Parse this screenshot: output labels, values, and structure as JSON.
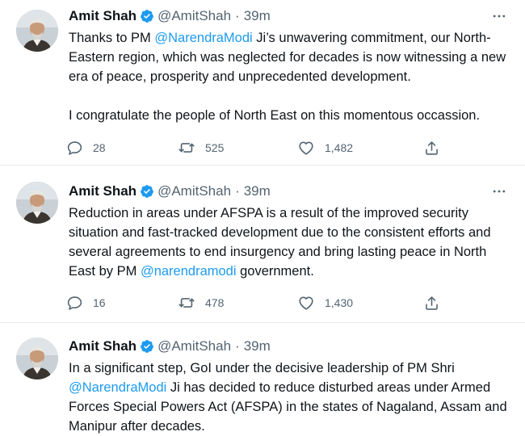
{
  "tweets": [
    {
      "author_name": "Amit Shah",
      "handle": "@AmitShah",
      "separator": "·",
      "time": "39m",
      "text_parts": [
        "Thanks to PM ",
        "@NarendraModi",
        " Ji’s unwavering commitment, our North-Eastern region, which was neglected for decades is now witnessing a new era of peace, prosperity and unprecedented development."
      ],
      "text_second_paragraph": "I congratulate the people of North East on this momentous occassion.",
      "replies": "28",
      "retweets": "525",
      "likes": "1,482"
    },
    {
      "author_name": "Amit Shah",
      "handle": "@AmitShah",
      "separator": "·",
      "time": "39m",
      "text_parts": [
        "Reduction in areas under AFSPA is a result of the improved security situation and fast-tracked development due to the consistent efforts and several agreements to end insurgency and bring lasting peace in North East by PM ",
        "@narendramodi",
        " government."
      ],
      "replies": "16",
      "retweets": "478",
      "likes": "1,430"
    },
    {
      "author_name": "Amit Shah",
      "handle": "@AmitShah",
      "separator": "·",
      "time": "39m",
      "text_parts": [
        "In a significant step, GoI under the decisive leadership of PM Shri ",
        "@NarendraModi",
        " Ji has decided to reduce disturbed areas under Armed Forces Special Powers Act (AFSPA) in the states of Nagaland, Assam and Manipur after decades."
      ]
    }
  ],
  "icons": {
    "verified": "verified-badge-icon",
    "more": "more-dots-icon",
    "reply": "reply-icon",
    "retweet": "retweet-icon",
    "like": "heart-icon",
    "share": "share-icon"
  },
  "colors": {
    "link": "#1d9bf0",
    "text": "#0f1419",
    "secondary": "#536471",
    "divider": "#e6ecf0"
  }
}
